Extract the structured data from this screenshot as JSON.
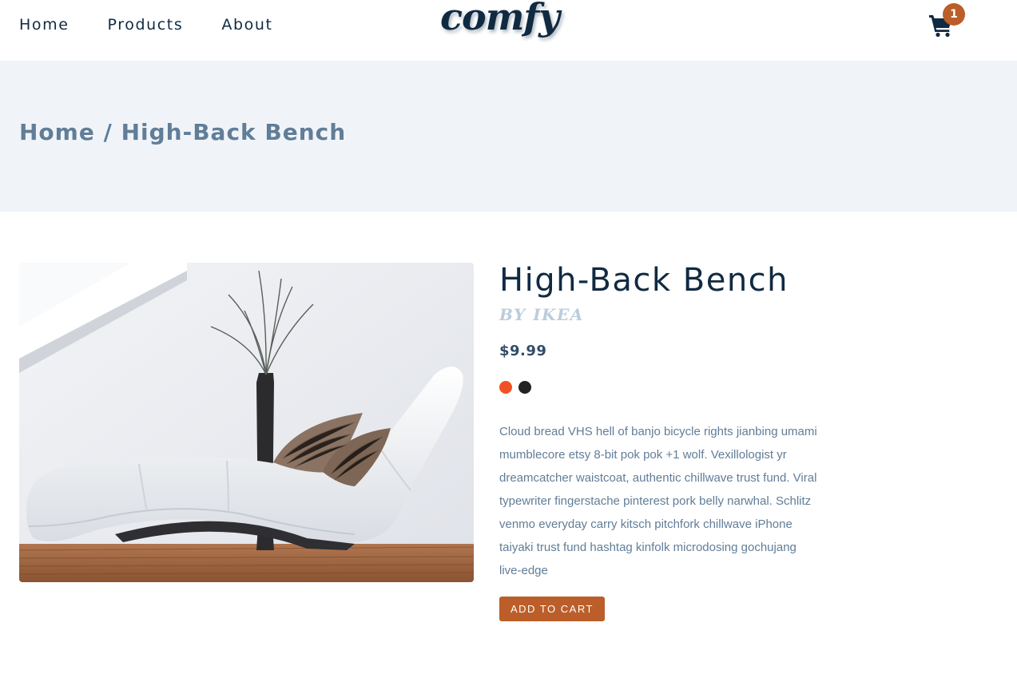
{
  "nav": {
    "links": [
      {
        "label": "Home"
      },
      {
        "label": "Products"
      },
      {
        "label": "About"
      }
    ],
    "logo": "comfy",
    "cart_count": "1"
  },
  "hero": {
    "breadcrumb_home": "Home",
    "breadcrumb_separator": " / ",
    "breadcrumb_current": "High-Back Bench"
  },
  "product": {
    "title": "High-Back Bench",
    "company": "BY IKEA",
    "price": "$9.99",
    "colors": [
      "#f15025",
      "#222222"
    ],
    "description": "Cloud bread VHS hell of banjo bicycle rights jianbing umami mumblecore etsy 8-bit pok pok +1 wolf. Vexillologist yr dreamcatcher waistcoat, authentic chillwave trust fund. Viral typewriter fingerstache pinterest pork belly narwhal. Schlitz venmo everyday carry kitsch pitchfork chillwave iPhone taiyaki trust fund hashtag kinfolk microdosing gochujang live-edge",
    "add_to_cart": "ADD TO CART",
    "image_icon": "chaise-lounge-photo"
  },
  "colors": {
    "primary": "#102a42",
    "accent": "#bb5e2a",
    "hero_bg": "#f0f4f8",
    "muted": "#617d98"
  }
}
